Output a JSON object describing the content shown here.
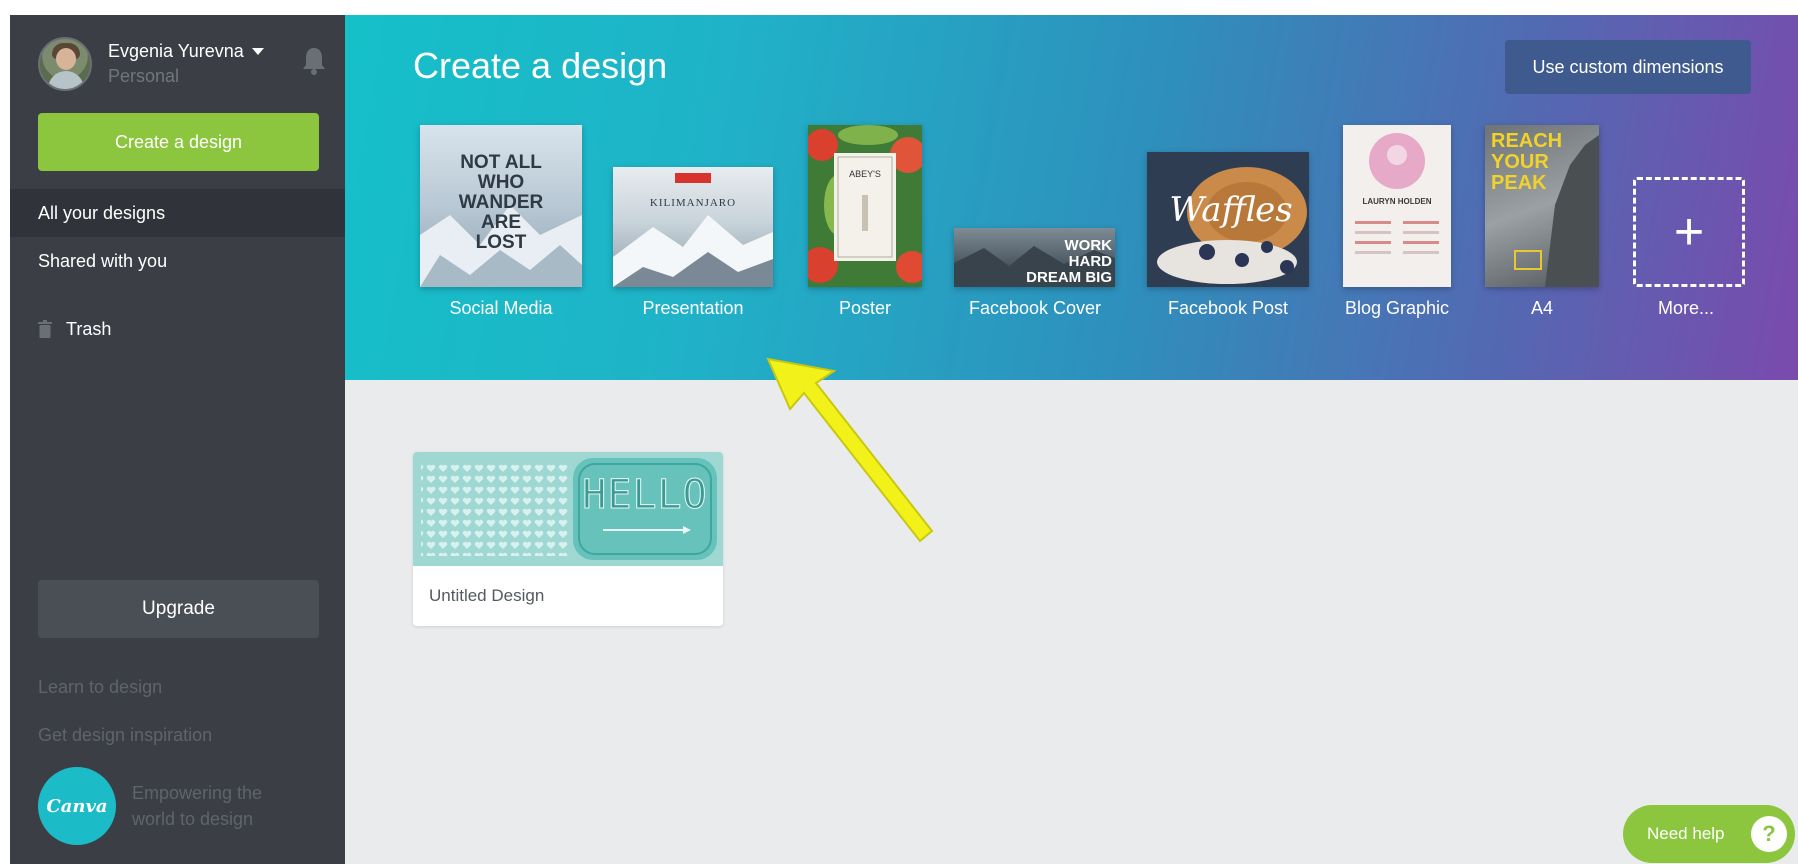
{
  "sidebar": {
    "user_name": "Evgenia Yurevna",
    "plan": "Personal",
    "create_button": "Create a design",
    "nav": [
      {
        "label": "All your designs",
        "active": true
      },
      {
        "label": "Shared with you",
        "active": false
      }
    ],
    "trash": "Trash",
    "upgrade_button": "Upgrade",
    "links": [
      "Learn to design",
      "Get design inspiration"
    ],
    "brand_logo": "Canva",
    "tagline": "Empowering the world to design"
  },
  "header": {
    "title": "Create a design",
    "custom_dimensions_button": "Use custom dimensions",
    "design_types": [
      {
        "label": "Social Media",
        "thumb_text": "NOT ALL WHO WANDER ARE LOST"
      },
      {
        "label": "Presentation",
        "thumb_text": "KILIMANJARO"
      },
      {
        "label": "Poster",
        "thumb_text": "ABEY'S"
      },
      {
        "label": "Facebook Cover",
        "thumb_text": "WORK HARD DREAM BIG"
      },
      {
        "label": "Facebook Post",
        "thumb_text": "Waffles"
      },
      {
        "label": "Blog Graphic",
        "thumb_text": "LAURYN HOLDEN"
      },
      {
        "label": "A4",
        "thumb_text": "REACH YOUR PEAK"
      },
      {
        "label": "More...",
        "thumb_text": "+"
      }
    ]
  },
  "designs": [
    {
      "label": "Untitled Design",
      "thumb_text": "HELLO"
    }
  ],
  "help_button": "Need help",
  "help_icon": "?",
  "colors": {
    "sidebar": "#3b3f45",
    "accent_green": "#8cc63f",
    "header_start": "#15c0c9",
    "header_end": "#7a4aad",
    "content_bg": "#e9ebed",
    "annotation_arrow": "#f2f21a"
  },
  "icons": [
    "bell-icon",
    "caret-down-icon",
    "trash-icon",
    "plus-icon",
    "question-icon",
    "annotation-arrow"
  ]
}
